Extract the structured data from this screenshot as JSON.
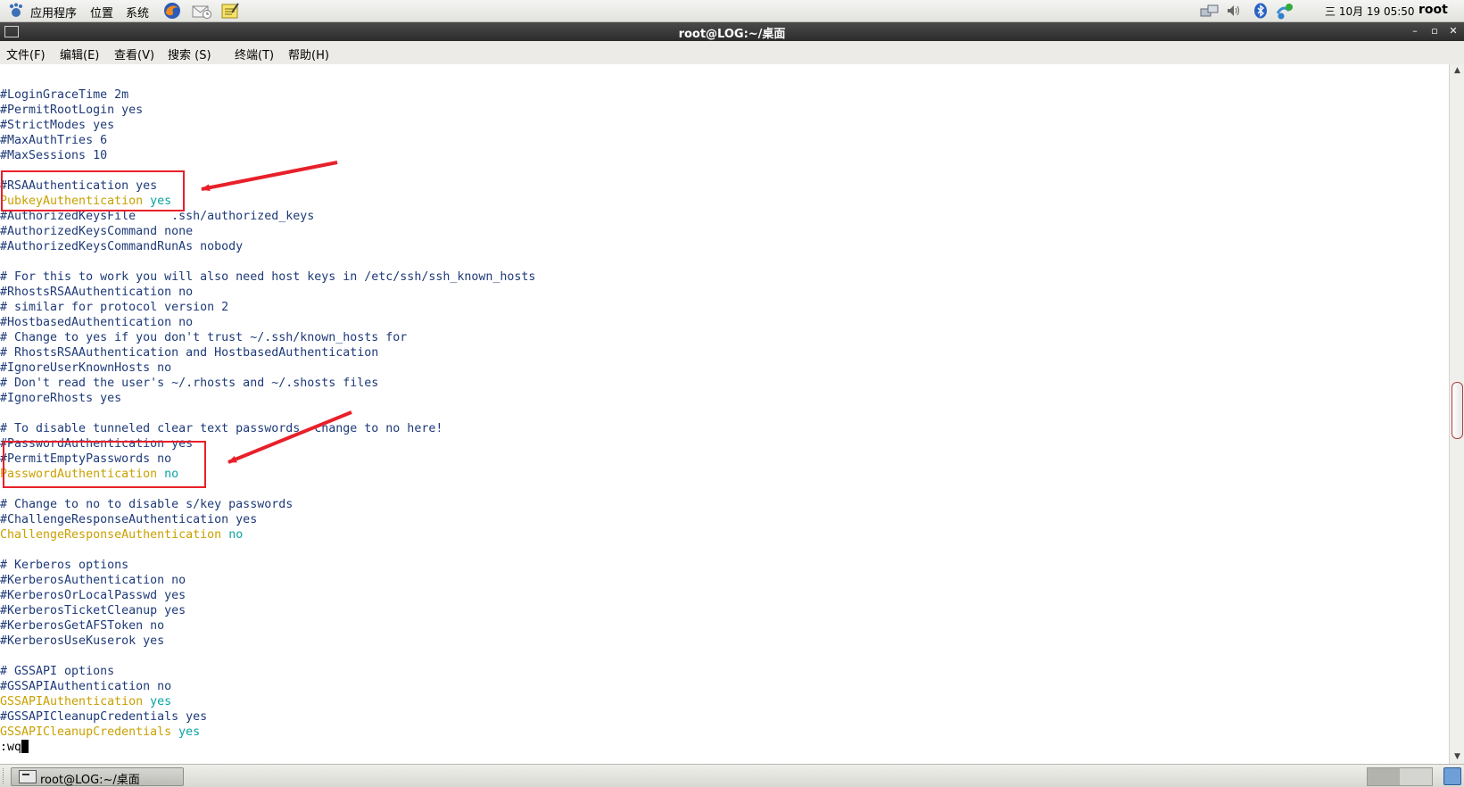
{
  "top_panel": {
    "menus": [
      "应用程序",
      "位置",
      "系统"
    ],
    "clock": "三 10月 19 05:50",
    "user": "root"
  },
  "window": {
    "title": "root@LOG:~/桌面"
  },
  "menubar": {
    "items": [
      "文件(F)",
      "编辑(E)",
      "查看(V)",
      "搜索 (S)",
      "终端(T)",
      "帮助(H)"
    ]
  },
  "terminal": {
    "lines": [
      {
        "text": "#LoginGraceTime 2m"
      },
      {
        "text": "#PermitRootLogin yes"
      },
      {
        "text": "#StrictModes yes"
      },
      {
        "text": "#MaxAuthTries 6"
      },
      {
        "text": "#MaxSessions 10"
      },
      {
        "text": ""
      },
      {
        "text": "#RSAAuthentication yes"
      },
      {
        "key": "PubkeyAuthentication",
        "value": "yes"
      },
      {
        "text": "#AuthorizedKeysFile     .ssh/authorized_keys"
      },
      {
        "text": "#AuthorizedKeysCommand none"
      },
      {
        "text": "#AuthorizedKeysCommandRunAs nobody"
      },
      {
        "text": ""
      },
      {
        "text": "# For this to work you will also need host keys in /etc/ssh/ssh_known_hosts"
      },
      {
        "text": "#RhostsRSAAuthentication no"
      },
      {
        "text": "# similar for protocol version 2"
      },
      {
        "text": "#HostbasedAuthentication no"
      },
      {
        "text": "# Change to yes if you don't trust ~/.ssh/known_hosts for"
      },
      {
        "text": "# RhostsRSAAuthentication and HostbasedAuthentication"
      },
      {
        "text": "#IgnoreUserKnownHosts no"
      },
      {
        "text": "# Don't read the user's ~/.rhosts and ~/.shosts files"
      },
      {
        "text": "#IgnoreRhosts yes"
      },
      {
        "text": ""
      },
      {
        "text": "# To disable tunneled clear text passwords, change to no here!"
      },
      {
        "text": "#PasswordAuthentication yes"
      },
      {
        "text": "#PermitEmptyPasswords no"
      },
      {
        "key": "PasswordAuthentication",
        "value": "no"
      },
      {
        "text": ""
      },
      {
        "text": "# Change to no to disable s/key passwords"
      },
      {
        "text": "#ChallengeResponseAuthentication yes"
      },
      {
        "key": "ChallengeResponseAuthentication",
        "value": "no"
      },
      {
        "text": ""
      },
      {
        "text": "# Kerberos options"
      },
      {
        "text": "#KerberosAuthentication no"
      },
      {
        "text": "#KerberosOrLocalPasswd yes"
      },
      {
        "text": "#KerberosTicketCleanup yes"
      },
      {
        "text": "#KerberosGetAFSToken no"
      },
      {
        "text": "#KerberosUseKuserok yes"
      },
      {
        "text": ""
      },
      {
        "text": "# GSSAPI options"
      },
      {
        "text": "#GSSAPIAuthentication no"
      },
      {
        "key": "GSSAPIAuthentication",
        "value": "yes"
      },
      {
        "text": "#GSSAPICleanupCredentials yes"
      },
      {
        "key": "GSSAPICleanupCredentials",
        "value": "yes"
      }
    ],
    "command": ":wq"
  },
  "taskbar": {
    "item_label": "root@LOG:~/桌面"
  },
  "icons": {
    "app_menu": "gnome-foot-icon",
    "browser": "firefox-icon",
    "mail": "evolution-mail-icon",
    "notes": "text-editor-icon",
    "network": "network-icon",
    "volume": "volume-icon",
    "bluetooth": "bluetooth-icon",
    "update": "update-notifier-icon"
  },
  "colors": {
    "comment": "#1e3a78",
    "keyword": "#c9a000",
    "value": "#0aa3a3",
    "annotation": "#e8202a"
  }
}
